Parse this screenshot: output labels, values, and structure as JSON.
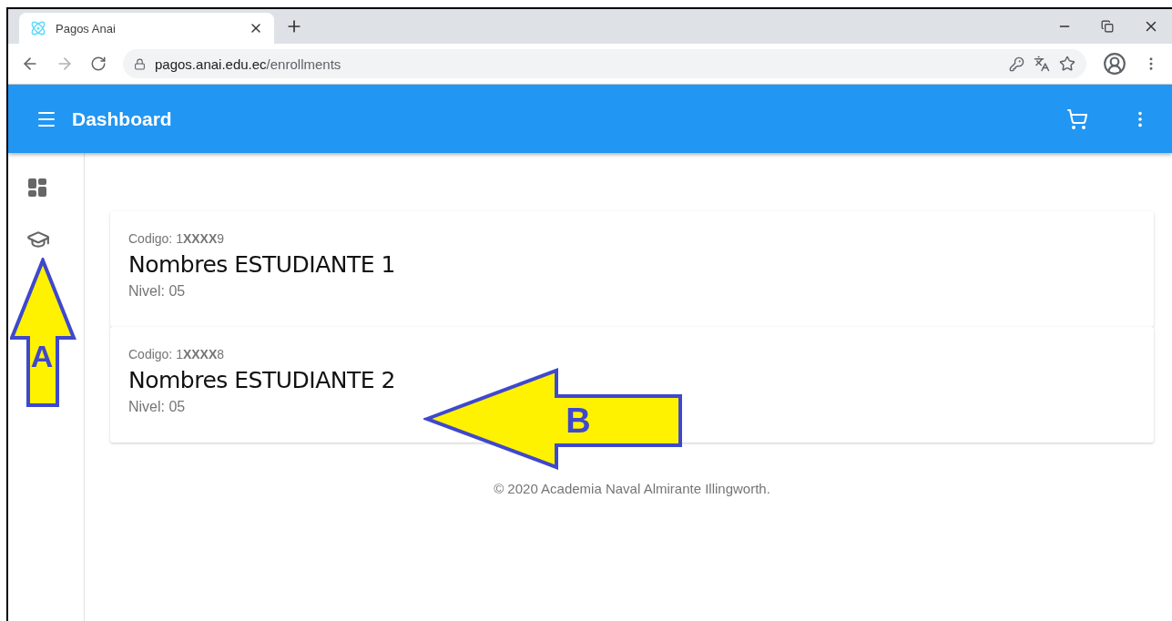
{
  "browser": {
    "tab_title": "Pagos Anai",
    "url_host": "pagos.anai.edu.ec",
    "url_path": "/enrollments"
  },
  "app_bar": {
    "title": "Dashboard"
  },
  "enrollments": [
    {
      "code": "Codigo: 1**XXXX**9",
      "name": "Nombres ESTUDIANTE 1",
      "level": "Nivel: 05"
    },
    {
      "code": "Codigo: 1**XXXX**8",
      "name": "Nombres ESTUDIANTE 2",
      "level": "Nivel: 05"
    }
  ],
  "footer": "© 2020 Academia Naval Almirante Illingworth.",
  "annotations": [
    {
      "label": "A",
      "kind": "up"
    },
    {
      "label": "B",
      "kind": "left"
    }
  ]
}
